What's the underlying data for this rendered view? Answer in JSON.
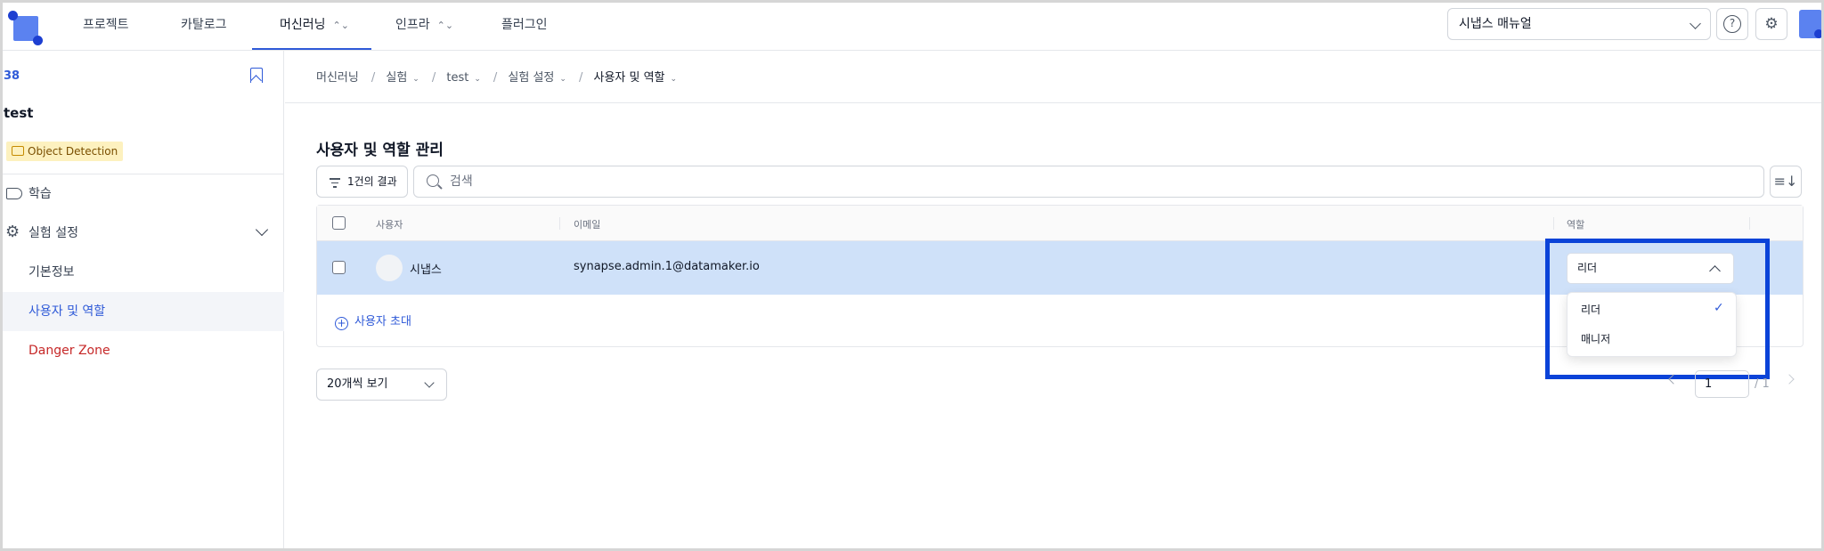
{
  "topnav": {
    "items": [
      {
        "label": "프로젝트",
        "has_chevron": false
      },
      {
        "label": "카탈로그",
        "has_chevron": false
      },
      {
        "label": "머신러닝",
        "has_chevron": true,
        "active": true
      },
      {
        "label": "인프라",
        "has_chevron": true
      },
      {
        "label": "플러그인",
        "has_chevron": false
      }
    ],
    "chevron_glyph": "⌃⌄",
    "workspace": "시냅스 매뉴얼",
    "help_glyph": "?",
    "settings_glyph": "⚙"
  },
  "sidebar": {
    "id": "38",
    "title": "test",
    "tag": "Object Detection",
    "items": [
      {
        "label": "학습"
      },
      {
        "label": "실험 설정"
      },
      {
        "label": "기본정보"
      },
      {
        "label": "사용자 및 역할",
        "active": true
      },
      {
        "label": "Danger Zone",
        "danger": true
      }
    ]
  },
  "breadcrumb": {
    "items": [
      "머신러닝",
      "실험",
      "test",
      "실험 설정",
      "사용자 및 역할"
    ],
    "separator": "/",
    "chevron": "⌄"
  },
  "page": {
    "title": "사용자 및 역할 관리",
    "filter_label": "1건의 결과",
    "search_placeholder": "검색",
    "sort_glyph": "≡↓"
  },
  "table": {
    "columns": [
      "사용자",
      "이메일",
      "역할"
    ],
    "rows": [
      {
        "name": "시냅스",
        "email": "synapse.admin.1@datamaker.io",
        "role": "리더"
      }
    ],
    "invite_label": "사용자 초대",
    "invite_glyph": "+"
  },
  "role_dropdown": {
    "options": [
      "리더",
      "매니저"
    ],
    "selected": "리더",
    "check_glyph": "✓"
  },
  "pagination": {
    "per_page": "20개씩 보기",
    "current_page": "1",
    "total": "/ 1"
  },
  "colors": {
    "accent": "#2f5ad8",
    "row_selected": "#cfe1f9",
    "highlight": "#0b43d8",
    "danger": "#c62828",
    "tag_bg": "#fdf1bf"
  }
}
